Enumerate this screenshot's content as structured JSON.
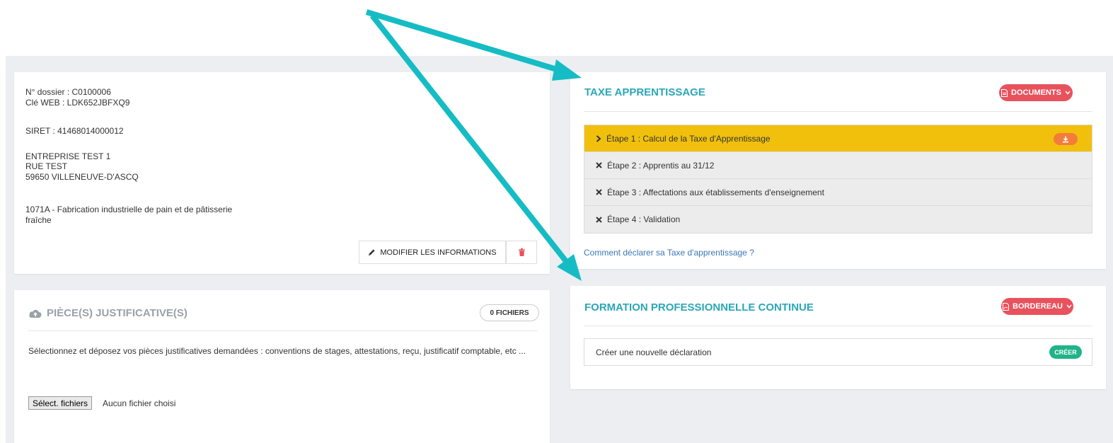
{
  "info": {
    "dossier": "N° dossier : C0100006",
    "cle_web": "Clé WEB : LDK652JBFXQ9",
    "siret": "SIRET : 41468014000012",
    "company": "ENTREPRISE TEST 1",
    "street": "RUE TEST",
    "city": "59650 VILLENEUVE-D'ASCQ",
    "activity_line1": "1071A - Fabrication industrielle de pain et de pâtisserie",
    "activity_line2": "fraîche",
    "modify_label": "MODIFIER LES INFORMATIONS"
  },
  "pieces": {
    "title": "PIÈCE(S) JUSTIFICATIVE(S)",
    "files_badge": "0 FICHIERS",
    "description": "Sélectionnez et déposez vos pièces justificatives demandées : conventions de stages, attestations, reçu, justificatif comptable, etc ...",
    "file_button": "Sélect. fichiers",
    "no_file": "Aucun fichier choisi"
  },
  "taxe": {
    "title": "TAXE APPRENTISSAGE",
    "documents_label": "DOCUMENTS",
    "steps": [
      {
        "label": "Étape 1 : Calcul de la Taxe d'Apprentissage"
      },
      {
        "label": "Étape 2 : Apprentis au 31/12"
      },
      {
        "label": "Étape 3 : Affectations aux établissements d'enseignement"
      },
      {
        "label": "Étape 4 : Validation"
      }
    ],
    "help_link": "Comment déclarer sa Taxe d'apprentissage ?"
  },
  "formation": {
    "title": "FORMATION PROFESSIONNELLE CONTINUE",
    "bordereau_label": "BORDEREAU",
    "new_declaration": "Créer une nouvelle déclaration",
    "create_label": "CRÉER"
  },
  "colors": {
    "accent_teal": "#2aa7b8",
    "arrow": "#16bcc4",
    "active_step": "#f0c00d",
    "danger": "#e8525d",
    "success": "#20b38a"
  }
}
